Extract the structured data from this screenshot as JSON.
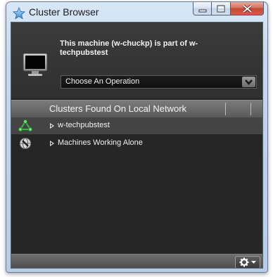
{
  "window": {
    "title": "Cluster Browser",
    "app_icon": "star-icon"
  },
  "caption_buttons": {
    "minimize": "minimize-icon",
    "maximize": "maximize-icon",
    "close": "close-icon"
  },
  "header": {
    "machine_status": "This machine (w-chuckp) is part of w-techpubstest",
    "machine_icon": "monitor-icon",
    "operation_select": {
      "value": "Choose An Operation",
      "icon": "chevron-down-icon"
    }
  },
  "list": {
    "column_header": "Clusters Found On Local Network",
    "items": [
      {
        "label": "w-techpubstest",
        "icon": "cluster-network-icon",
        "selected": true
      },
      {
        "label": "Machines Working Alone",
        "icon": "standalone-machine-icon",
        "selected": false
      }
    ]
  },
  "footer": {
    "menu_button_icon": "gear-icon"
  },
  "colors": {
    "client_bg": "#262626",
    "header_bg": "#333333",
    "selected_row": "#444444",
    "cluster_icon_green": "#3bb54a",
    "close_button_red": "#c24a33"
  }
}
